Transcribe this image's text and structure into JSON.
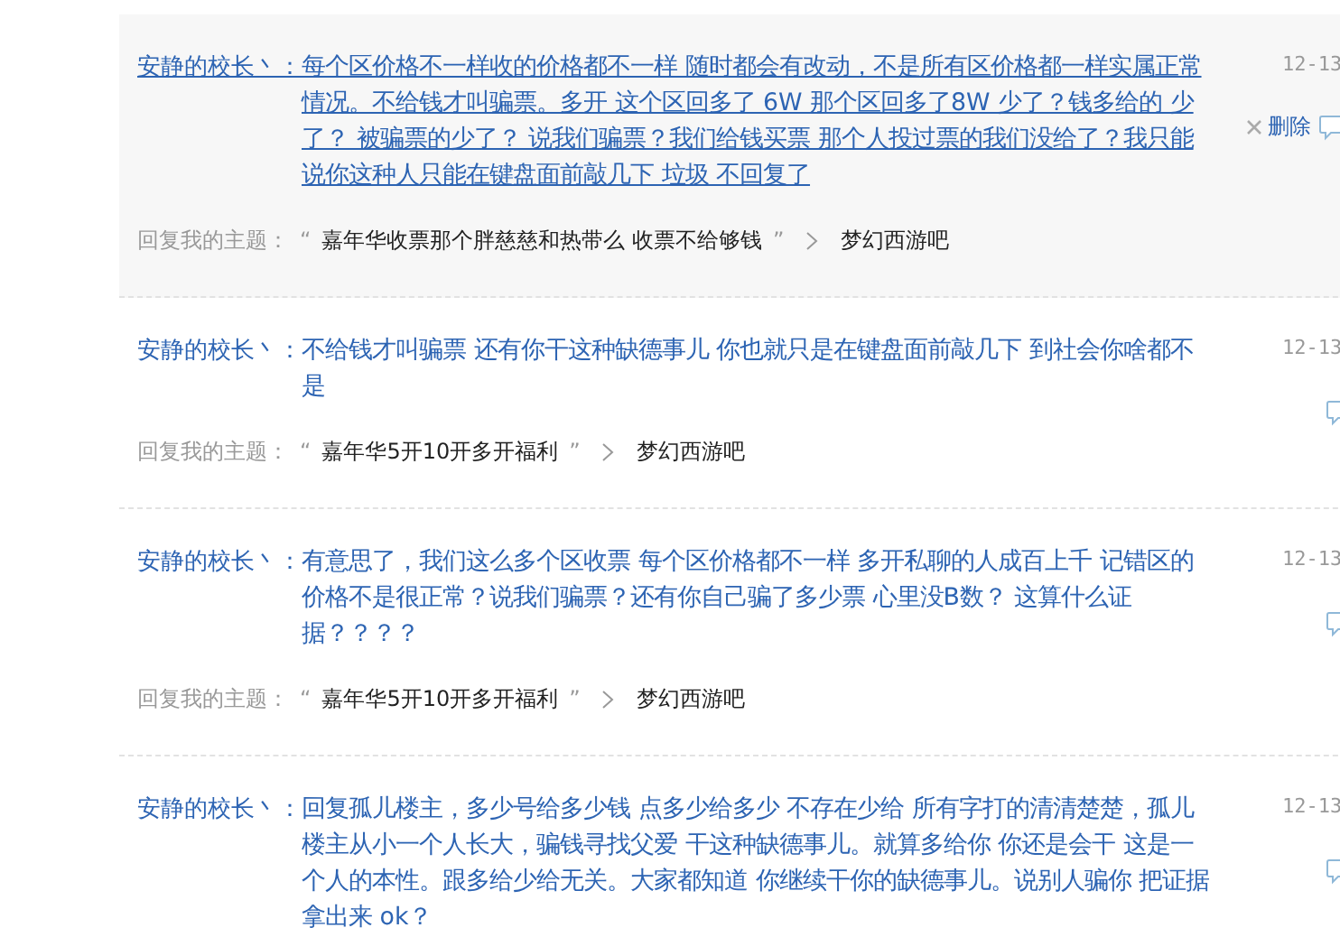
{
  "replies": [
    {
      "author": "安静的校长丶：",
      "text": "每个区价格不一样收的价格都不一样 随时都会有改动，不是所有区价格都一样实属正常情况。不给钱才叫骗票。多开 这个区回多了 6W 那个区回多了8W 少了？钱多给的 少了？ 被骗票的少了？ 说我们骗票？我们给钱买票 那个人投过票的我们没给了？我只能说你这种人只能在键盘面前敲几下 垃圾 不回复了",
      "date": "12-13",
      "hovered": true,
      "delete_label": "删除",
      "topic_label": "回复我的主题：",
      "quote_open": "“",
      "topic": "嘉年华收票那个胖慈慈和热带么 收票不给够钱",
      "quote_close": "”",
      "forum": "梦幻西游吧"
    },
    {
      "author": "安静的校长丶：",
      "text": "不给钱才叫骗票 还有你干这种缺德事儿 你也就只是在键盘面前敲几下 到社会你啥都不是",
      "date": "12-13",
      "hovered": false,
      "topic_label": "回复我的主题：",
      "quote_open": "“",
      "topic": "嘉年华5开10开多开福利",
      "quote_close": "”",
      "forum": "梦幻西游吧"
    },
    {
      "author": "安静的校长丶：",
      "text": "有意思了，我们这么多个区收票 每个区价格都不一样 多开私聊的人成百上千 记错区的价格不是很正常？说我们骗票？还有你自己骗了多少票 心里没B数？ 这算什么证据？？？？",
      "date": "12-13",
      "hovered": false,
      "topic_label": "回复我的主题：",
      "quote_open": "“",
      "topic": "嘉年华5开10开多开福利",
      "quote_close": "”",
      "forum": "梦幻西游吧"
    },
    {
      "author": "安静的校长丶：",
      "text": "回复孤儿楼主，多少号给多少钱 点多少给多少 不存在少给 所有字打的清清楚楚，孤儿楼主从小一个人长大，骗钱寻找父爱 干这种缺德事儿。就算多给你 你还是会干 这是一个人的本性。跟多给少给无关。大家都知道 你继续干你的缺德事儿。说别人骗你 把证据拿出来 ok？",
      "date": "12-13",
      "hovered": false
    }
  ]
}
